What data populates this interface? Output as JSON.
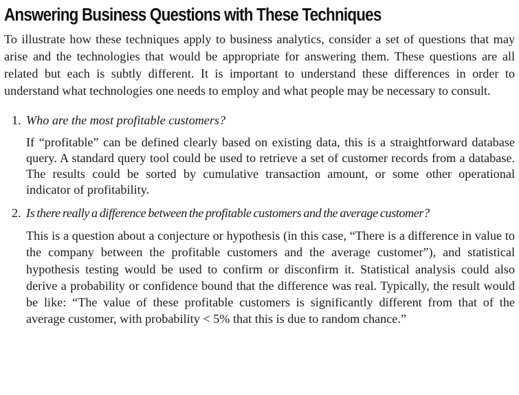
{
  "document": {
    "title": "Answering Business Questions with These Techniques",
    "intro": "To illustrate how these techniques apply to business analytics, consider a set of questions that may arise and the technologies that would be appropriate for answering them. These questions are all related but each is subtly different. It is important to understand these differences in order to understand what technologies one needs to employ and what people may be necessary to consult.",
    "items": [
      {
        "number": "1.",
        "question": "Who are the most profitable customers?",
        "answer": "If “profitable” can be defined clearly based on existing data, this is a straightforward database query. A standard query tool could be used to retrieve a set of customer records from a database. The results could be sorted by cumulative transaction amount, or some other operational indicator of profitability."
      },
      {
        "number": "2.",
        "question": "Is there really a difference between the profitable customers and the average customer?",
        "answer": "This is a question about a conjecture or hypothesis (in this case, “There is a differ­ence in value to the company between the profitable customers and the average customer”), and statistical hypothesis testing would be used to confirm or disconfirm it. Statistical analysis could also derive a probability or confidence bound that the difference was real. Typically, the result would be like: “The value of these profitable customers is significantly different from that of the average cus­tomer, with probability < 5% that this is due to random chance.”"
      }
    ]
  }
}
